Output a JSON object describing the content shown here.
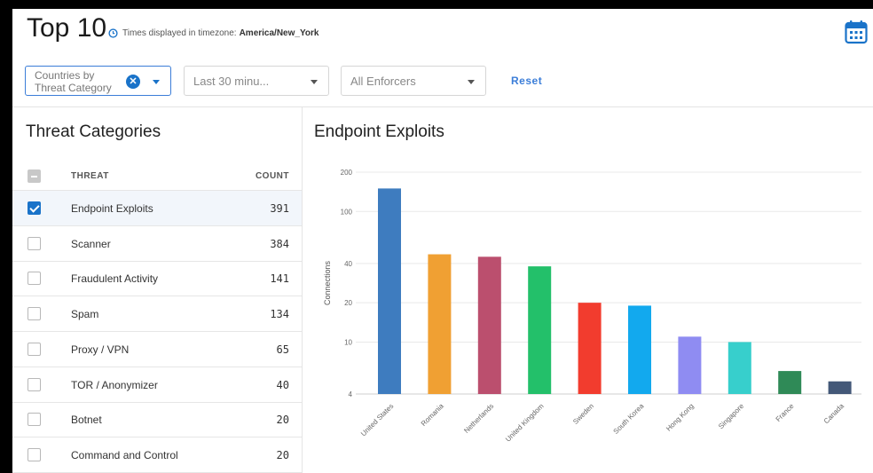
{
  "header": {
    "title": "Top 10",
    "tz_label": "Times displayed in timezone:",
    "tz_value": "America/New_York"
  },
  "filters": {
    "category": "Countries by Threat Category",
    "time": "Last 30 minu...",
    "enforcers": "All Enforcers",
    "reset": "Reset"
  },
  "threats": {
    "title": "Threat Categories",
    "col_threat": "THREAT",
    "col_count": "COUNT",
    "rows": [
      {
        "name": "Endpoint Exploits",
        "count": "391",
        "checked": true
      },
      {
        "name": "Scanner",
        "count": "384",
        "checked": false
      },
      {
        "name": "Fraudulent Activity",
        "count": "141",
        "checked": false
      },
      {
        "name": "Spam",
        "count": "134",
        "checked": false
      },
      {
        "name": "Proxy / VPN",
        "count": "65",
        "checked": false
      },
      {
        "name": "TOR / Anonymizer",
        "count": "40",
        "checked": false
      },
      {
        "name": "Botnet",
        "count": "20",
        "checked": false
      },
      {
        "name": "Command and Control",
        "count": "20",
        "checked": false
      }
    ]
  },
  "chart_data": {
    "type": "bar",
    "title": "Endpoint Exploits",
    "ylabel": "Connections",
    "xlabel": "",
    "yscale": "log",
    "ylim": [
      4,
      200
    ],
    "yticks": [
      "4",
      "10",
      "20",
      "40",
      "100",
      "200"
    ],
    "grid": true,
    "categories": [
      "United States",
      "Romania",
      "Netherlands",
      "United Kingdom",
      "Sweden",
      "South Korea",
      "Hong Kong",
      "Singapore",
      "France",
      "Canada"
    ],
    "values": [
      150,
      47,
      45,
      38,
      20,
      19,
      11,
      10,
      6,
      5
    ],
    "colors": [
      "#3e7cbf",
      "#f0a033",
      "#bb4f6e",
      "#23c06a",
      "#f23c2e",
      "#12a9ee",
      "#8f8cf2",
      "#37cfcc",
      "#2f8a57",
      "#435878"
    ]
  }
}
